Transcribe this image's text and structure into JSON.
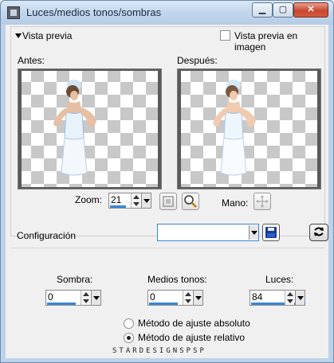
{
  "window": {
    "title": "Luces/medios tonos/sombras",
    "min_glyph": "▁",
    "max_glyph": "▢",
    "close_glyph": "✕"
  },
  "preview": {
    "section_label": "Vista previa",
    "image_preview_checkbox": {
      "label": "Vista previa en imagen",
      "checked": false
    },
    "before_label": "Antes:",
    "after_label": "Después:",
    "zoom_label": "Zoom:",
    "zoom_value": "21",
    "pan_label": "Mano:"
  },
  "config": {
    "label": "Configuración",
    "preset_value": ""
  },
  "params": {
    "shadow_label": "Sombra:",
    "shadow_value": "0",
    "midtones_label": "Medios tonos:",
    "midtones_value": "0",
    "highlights_label": "Luces:",
    "highlights_value": "84"
  },
  "method": {
    "absolute_label": "Método de ajuste absoluto",
    "relative_label": "Método de ajuste relativo",
    "selected": "relative"
  },
  "watermark": "STARDESIGNSPSP",
  "colors": {
    "accent": "#3a86d9",
    "titlebar": "#c2d6ec",
    "close": "#c8482f"
  }
}
